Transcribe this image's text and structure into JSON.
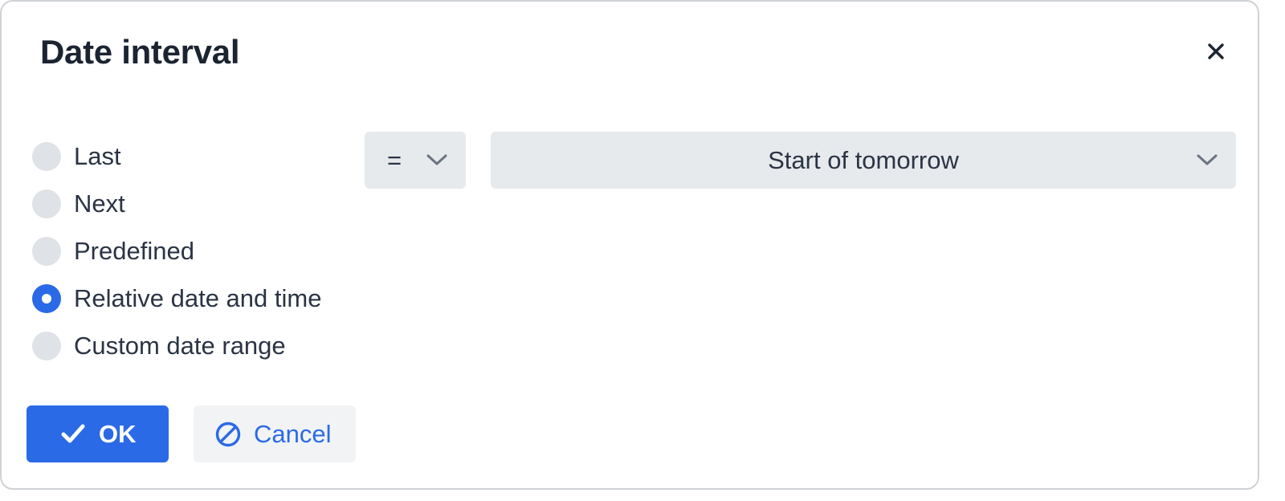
{
  "dialog": {
    "title": "Date interval",
    "close_icon": "close-icon"
  },
  "options": {
    "items": [
      {
        "label": "Last",
        "checked": false
      },
      {
        "label": "Next",
        "checked": false
      },
      {
        "label": "Predefined",
        "checked": false
      },
      {
        "label": "Relative date and time",
        "checked": true
      },
      {
        "label": "Custom date range",
        "checked": false
      }
    ]
  },
  "operator": {
    "value": "=",
    "icon": "chevron-down-icon"
  },
  "relative_value": {
    "value": "Start of tomorrow",
    "icon": "chevron-down-icon"
  },
  "buttons": {
    "ok_label": "OK",
    "ok_icon": "checkmark-icon",
    "cancel_label": "Cancel",
    "cancel_icon": "ban-icon"
  },
  "colors": {
    "accent": "#2b6ae6",
    "field_bg": "#e7eaed",
    "text": "#2b3444",
    "title": "#1c2432"
  }
}
